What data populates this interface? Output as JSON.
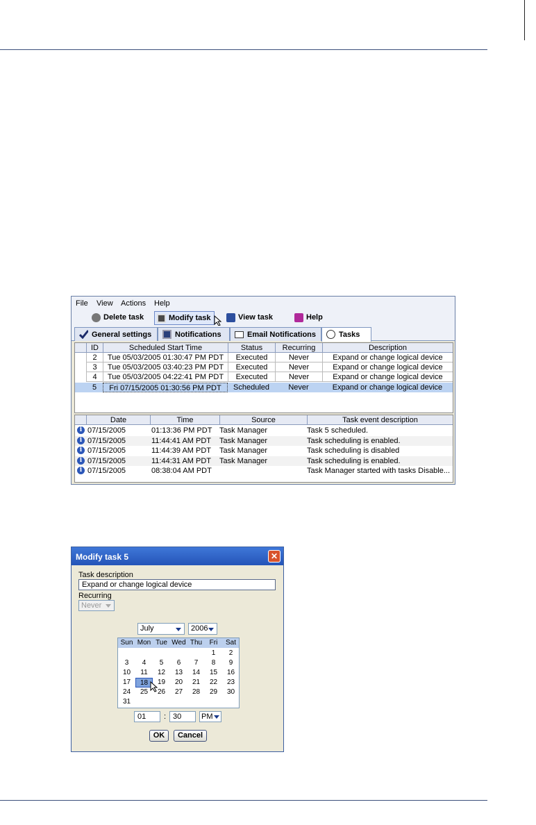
{
  "win1": {
    "menu": [
      "File",
      "View",
      "Actions",
      "Help"
    ],
    "toolbar": [
      {
        "label": "Delete task",
        "icon": "delete-task-icon"
      },
      {
        "label": "Modify task",
        "icon": "modify-task-icon"
      },
      {
        "label": "View task",
        "icon": "view-task-icon"
      },
      {
        "label": "Help",
        "icon": "help-book-icon"
      }
    ],
    "tabs": [
      {
        "label": "General settings",
        "icon": "checkmark-icon"
      },
      {
        "label": "Notifications",
        "icon": "computer-icon"
      },
      {
        "label": "Email Notifications",
        "icon": "envelope-icon"
      },
      {
        "label": "Tasks",
        "icon": "clock-icon"
      }
    ],
    "tasks": {
      "columns": [
        "ID",
        "Scheduled Start Time",
        "Status",
        "Recurring",
        "Description"
      ],
      "rows": [
        [
          "2",
          "Tue 05/03/2005 01:30:47 PM PDT",
          "Executed",
          "Never",
          "Expand or change logical device"
        ],
        [
          "3",
          "Tue 05/03/2005 03:40:23 PM PDT",
          "Executed",
          "Never",
          "Expand or change logical device"
        ],
        [
          "4",
          "Tue 05/03/2005 04:22:41 PM PDT",
          "Executed",
          "Never",
          "Expand or change logical device"
        ],
        [
          "5",
          "Fri 07/15/2005 01:30:56 PM PDT",
          "Scheduled",
          "Never",
          "Expand or change logical device"
        ]
      ]
    },
    "events": {
      "columns": [
        "Date",
        "Time",
        "Source",
        "Task event description"
      ],
      "rows": [
        [
          "07/15/2005",
          "01:13:36 PM PDT",
          "Task Manager",
          "Task 5 scheduled."
        ],
        [
          "07/15/2005",
          "11:44:41 AM PDT",
          "Task Manager",
          "Task scheduling is enabled."
        ],
        [
          "07/15/2005",
          "11:44:39 AM PDT",
          "Task Manager",
          "Task scheduling is disabled"
        ],
        [
          "07/15/2005",
          "11:44:31 AM PDT",
          "Task Manager",
          "Task scheduling is enabled."
        ],
        [
          "07/15/2005",
          "08:38:04 AM PDT",
          "",
          "Task Manager started with tasks Disable..."
        ]
      ]
    }
  },
  "dialog": {
    "title": "Modify task 5",
    "close": "✕",
    "desc_label": "Task description",
    "desc_value": "Expand or change logical device",
    "recurring_label": "Recurring",
    "recurring_value": "Never",
    "month": "July",
    "year": "2006",
    "daynames": [
      "Sun",
      "Mon",
      "Tue",
      "Wed",
      "Thu",
      "Fri",
      "Sat"
    ],
    "weeks": [
      [
        "",
        "",
        "",
        "",
        "",
        "1",
        "2"
      ],
      [
        "3",
        "4",
        "5",
        "6",
        "7",
        "8",
        "9"
      ],
      [
        "10",
        "11",
        "12",
        "13",
        "14",
        "15",
        "16"
      ],
      [
        "17",
        "18",
        "19",
        "20",
        "21",
        "22",
        "23"
      ],
      [
        "24",
        "25",
        "26",
        "27",
        "28",
        "29",
        "30"
      ],
      [
        "31",
        "",
        "",
        "",
        "",
        "",
        ""
      ]
    ],
    "selected_day": "18",
    "hour": "01",
    "colon": ":",
    "minute": "30",
    "ampm": "PM",
    "ok": "OK",
    "cancel": "Cancel"
  }
}
